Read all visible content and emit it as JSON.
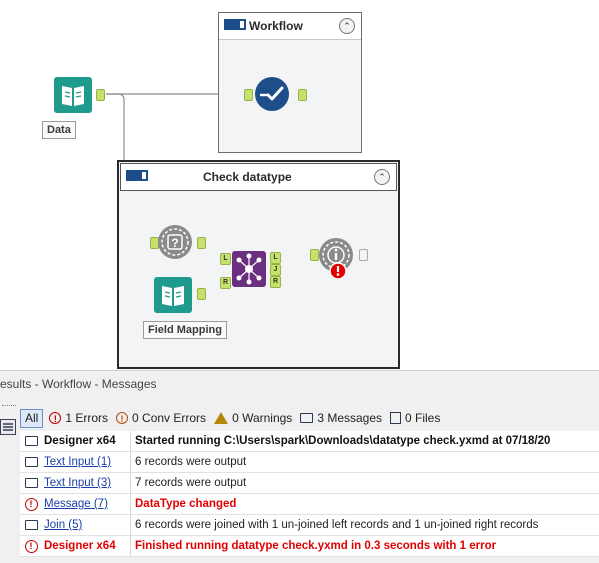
{
  "canvas": {
    "workflow_container": {
      "title": "Workflow"
    },
    "check_container": {
      "title": "Check datatype"
    },
    "data_label": "Data",
    "field_mapping_label": "Field Mapping",
    "join_anchors": {
      "left": "L",
      "right": "R",
      "out_left": "L",
      "out_join": "J",
      "out_right": "R"
    }
  },
  "results": {
    "title": "esults - Workflow - Messages",
    "filters": {
      "all": "All",
      "errors": "1 Errors",
      "conv_errors": "0 Conv Errors",
      "warnings": "0 Warnings",
      "messages": "3 Messages",
      "files": "0 Files"
    },
    "rows": [
      {
        "type": "message",
        "source": "Designer x64",
        "message": "Started running C:\\Users\\spark\\Downloads\\datatype check.yxmd at 07/18/20"
      },
      {
        "type": "message",
        "source": "Text Input (1)",
        "message": "6 records were output"
      },
      {
        "type": "message",
        "source": "Text Input (3)",
        "message": "7 records were output"
      },
      {
        "type": "error",
        "source": "Message (7)",
        "message": "DataType changed"
      },
      {
        "type": "message",
        "source": "Join (5)",
        "message": "6 records were joined with 1 un-joined left records and 1 un-joined right records"
      },
      {
        "type": "error",
        "source": "Designer x64",
        "message": "Finished running datatype check.yxmd in 0.3 seconds with 1 error"
      }
    ]
  },
  "colors": {
    "anchor_green": "#c5e26d",
    "tool_teal": "#1f9a8c",
    "tool_navy": "#1d4e89",
    "join_purple": "#6b2f7f",
    "message_gray": "#8a8a8a",
    "error_red": "#e00000",
    "link_blue": "#1a3fa8"
  }
}
